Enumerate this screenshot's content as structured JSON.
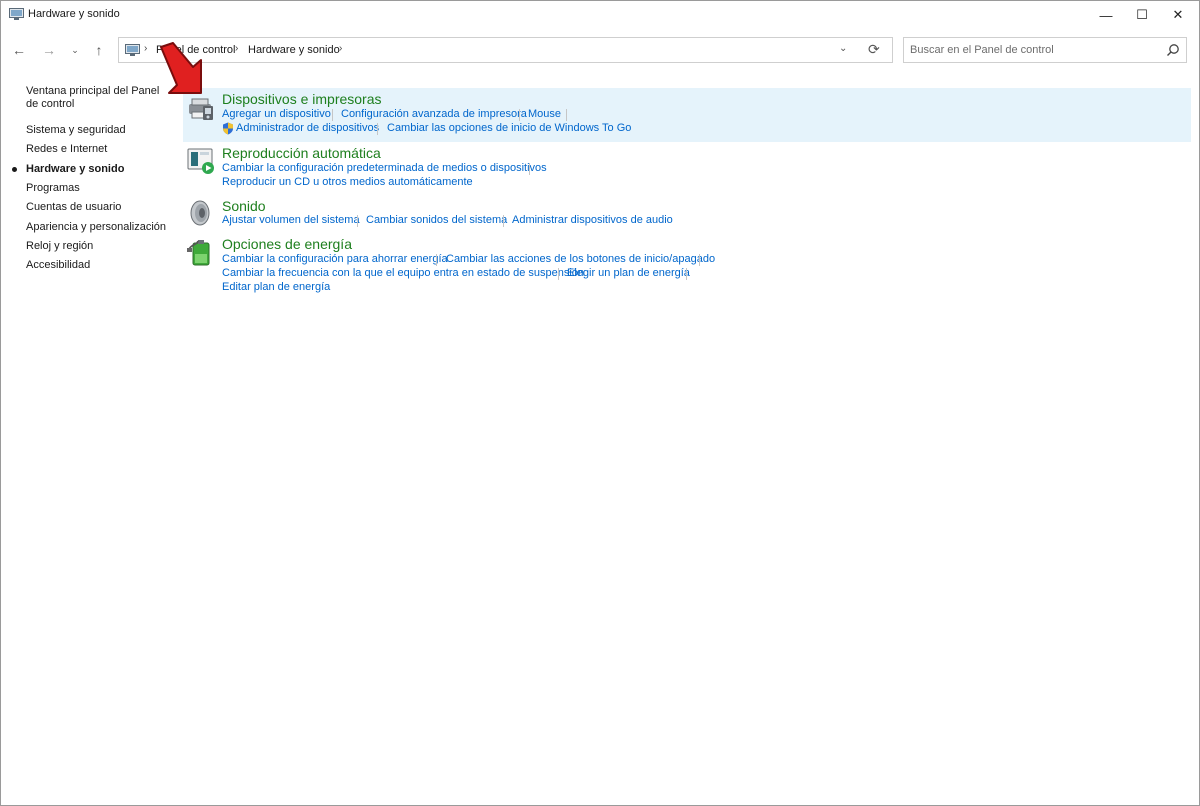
{
  "window": {
    "title": "Hardware y sonido",
    "controls": {
      "minimize": "—",
      "maximize": "☐",
      "close": "✕"
    },
    "icon": "control-panel-icon"
  },
  "nav": {
    "back": "←",
    "forward": "→",
    "recent": "⌄",
    "up": "↑",
    "breadcrumb": [
      "Panel de control",
      "Hardware y sonido"
    ],
    "breadcrumb_sep": "›",
    "dropdown": "⌄",
    "refresh": "⟳",
    "search_placeholder": "Buscar en el Panel de control"
  },
  "sidebar": {
    "items": [
      {
        "label": "Ventana principal del Panel de control",
        "active": false
      },
      {
        "label": "Sistema y seguridad",
        "active": false
      },
      {
        "label": "Redes e Internet",
        "active": false
      },
      {
        "label": "Hardware y sonido",
        "active": true
      },
      {
        "label": "Programas",
        "active": false
      },
      {
        "label": "Cuentas de usuario",
        "active": false
      },
      {
        "label": "Apariencia y personalización",
        "active": false
      },
      {
        "label": "Reloj y región",
        "active": false
      },
      {
        "label": "Accesibilidad",
        "active": false
      }
    ]
  },
  "categories": [
    {
      "title": "Dispositivos e impresoras",
      "icon": "devices-printers-icon",
      "links": [
        "Agregar un dispositivo",
        "Configuración avanzada de impresora",
        "Mouse",
        "Administrador de dispositivos",
        "Cambiar las opciones de inicio de Windows To Go"
      ]
    },
    {
      "title": "Reproducción automática",
      "icon": "autoplay-icon",
      "links": [
        "Cambiar la configuración predeterminada de medios o dispositivos",
        "Reproducir un CD u otros medios automáticamente"
      ]
    },
    {
      "title": "Sonido",
      "icon": "speaker-icon",
      "links": [
        "Ajustar volumen del sistema",
        "Cambiar sonidos del sistema",
        "Administrar dispositivos de audio"
      ]
    },
    {
      "title": "Opciones de energía",
      "icon": "power-options-icon",
      "links": [
        "Cambiar la configuración para ahorrar energía",
        "Cambiar las acciones de los botones de inicio/apagado",
        "Cambiar la frecuencia con la que el equipo entra en estado de suspensión",
        "Elegir un plan de energía",
        "Editar plan de energía"
      ]
    }
  ],
  "colors": {
    "link": "#0066cc",
    "category_title": "#1e7f1e",
    "highlight": "#e5f3fb",
    "annotation_arrow": "#e02020"
  }
}
